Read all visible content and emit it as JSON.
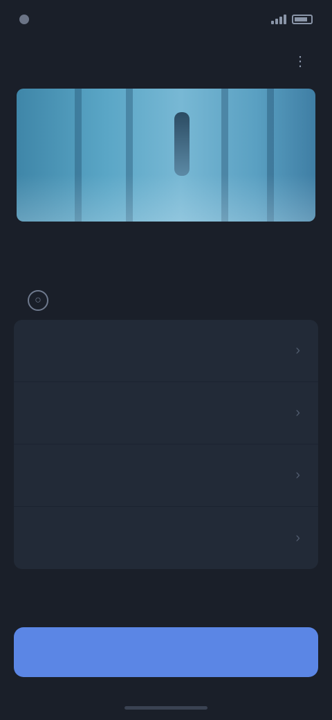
{
  "status_bar": {
    "time": "",
    "carrier": ""
  },
  "header": {
    "title": "",
    "more_icon": "more-icon"
  },
  "hero": {
    "caption_line1": "",
    "caption_line2": ""
  },
  "meta": {
    "left_text": "",
    "right_text": ""
  },
  "option": {
    "icon": "circle-icon",
    "label": ""
  },
  "list": {
    "items": [
      {
        "label": "",
        "chevron": "›"
      },
      {
        "label": "",
        "chevron": "›"
      },
      {
        "label": "",
        "chevron": "›"
      },
      {
        "label": "",
        "chevron": "›"
      }
    ]
  },
  "cta": {
    "label": ""
  },
  "colors": {
    "background": "#1a1f29",
    "card": "#222a37",
    "accent": "#5b86e5"
  }
}
